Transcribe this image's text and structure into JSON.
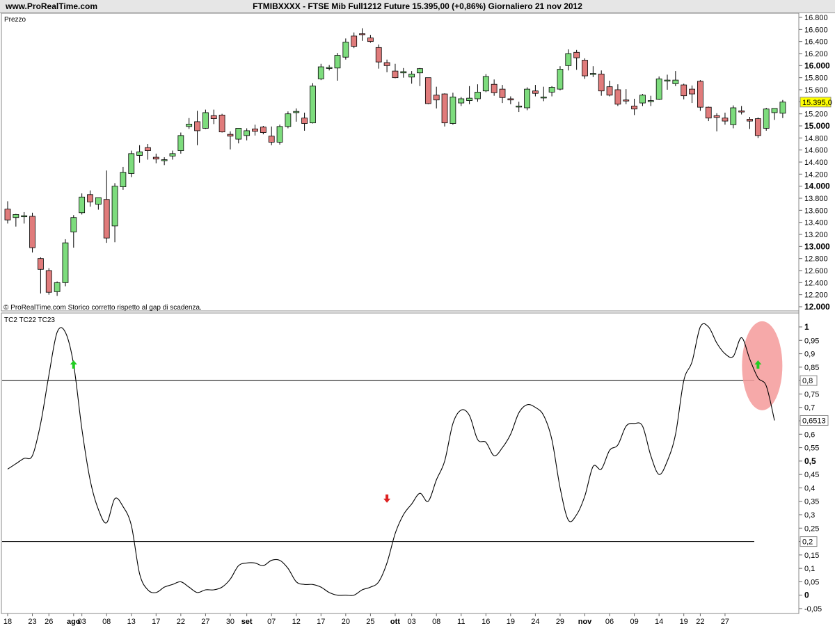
{
  "header": {
    "site": "www.ProRealTime.com",
    "info": "FTMIBXXXX - FTSE Mib Full1212 Future     15.395,00 (+0,86%)    Giornaliero  21 nov 2012"
  },
  "price_panel": {
    "label": "Prezzo",
    "footer": "© ProRealTime.com  Storico corretto rispetto al gap di scadenza.",
    "current_label": "15.395,0"
  },
  "indicator_panel": {
    "label": "TC2 TC22 TC23",
    "current_label": "0,6513",
    "upper_level_label": "0,8",
    "lower_level_label": "0,2"
  },
  "colors": {
    "up": "#7ddc7d",
    "down": "#e07b7b",
    "highlight": "#f59a9a",
    "arrow_up": "#22cc22",
    "arrow_down": "#dd2222",
    "current_box": "#ffff00"
  },
  "x_axis": {
    "labels": [
      {
        "i": 0,
        "text": "18"
      },
      {
        "i": 3,
        "text": "23"
      },
      {
        "i": 5,
        "text": "26"
      },
      {
        "i": 8,
        "text": "ago",
        "bold": true
      },
      {
        "i": 9,
        "text": "03"
      },
      {
        "i": 12,
        "text": "08"
      },
      {
        "i": 15,
        "text": "13"
      },
      {
        "i": 18,
        "text": "17"
      },
      {
        "i": 21,
        "text": "22"
      },
      {
        "i": 24,
        "text": "27"
      },
      {
        "i": 27,
        "text": "30"
      },
      {
        "i": 29,
        "text": "set",
        "bold": true
      },
      {
        "i": 32,
        "text": "07"
      },
      {
        "i": 35,
        "text": "12"
      },
      {
        "i": 38,
        "text": "17"
      },
      {
        "i": 41,
        "text": "20"
      },
      {
        "i": 44,
        "text": "25"
      },
      {
        "i": 47,
        "text": "ott",
        "bold": true
      },
      {
        "i": 49,
        "text": "03"
      },
      {
        "i": 52,
        "text": "08"
      },
      {
        "i": 55,
        "text": "11"
      },
      {
        "i": 58,
        "text": "16"
      },
      {
        "i": 61,
        "text": "19"
      },
      {
        "i": 64,
        "text": "24"
      },
      {
        "i": 67,
        "text": "29"
      },
      {
        "i": 70,
        "text": "nov",
        "bold": true
      },
      {
        "i": 73,
        "text": "06"
      },
      {
        "i": 76,
        "text": "09"
      },
      {
        "i": 79,
        "text": "14"
      },
      {
        "i": 82,
        "text": "19"
      },
      {
        "i": 84,
        "text": "22"
      },
      {
        "i": 87,
        "text": "27"
      }
    ]
  },
  "chart_data": [
    {
      "type": "candlestick",
      "ylim": [
        12000,
        16800
      ],
      "y_ticks": [
        12000,
        12200,
        12400,
        12600,
        12800,
        13000,
        13200,
        13400,
        13600,
        13800,
        14000,
        14200,
        14400,
        14600,
        14800,
        15000,
        15200,
        15400,
        15600,
        15800,
        16000,
        16200,
        16400,
        16600,
        16800
      ],
      "y_tick_labels": [
        "12.000",
        "12.200",
        "12.400",
        "12.600",
        "12.800",
        "13.000",
        "13.200",
        "13.400",
        "13.600",
        "13.800",
        "14.000",
        "14.200",
        "14.400",
        "14.600",
        "14.800",
        "15.000",
        "15.200",
        "15.400",
        "15.600",
        "15.800",
        "16.000",
        "16.200",
        "16.400",
        "16.600",
        "16.800"
      ],
      "y_major": [
        12000,
        13000,
        14000,
        15000,
        16000
      ],
      "candles": [
        {
          "o": 13620,
          "h": 13750,
          "l": 13380,
          "c": 13440
        },
        {
          "o": 13480,
          "h": 13540,
          "l": 13330,
          "c": 13530
        },
        {
          "o": 13510,
          "h": 13570,
          "l": 13380,
          "c": 13510
        },
        {
          "o": 13500,
          "h": 13560,
          "l": 12900,
          "c": 12980
        },
        {
          "o": 12800,
          "h": 12820,
          "l": 12220,
          "c": 12620
        },
        {
          "o": 12600,
          "h": 12640,
          "l": 12200,
          "c": 12240
        },
        {
          "o": 12250,
          "h": 12420,
          "l": 12180,
          "c": 12400
        },
        {
          "o": 12400,
          "h": 13120,
          "l": 12340,
          "c": 13060
        },
        {
          "o": 13240,
          "h": 13520,
          "l": 12980,
          "c": 13480
        },
        {
          "o": 13560,
          "h": 13880,
          "l": 13530,
          "c": 13820
        },
        {
          "o": 13860,
          "h": 13930,
          "l": 13660,
          "c": 13740
        },
        {
          "o": 13700,
          "h": 13810,
          "l": 13610,
          "c": 13810
        },
        {
          "o": 13780,
          "h": 14260,
          "l": 13060,
          "c": 13140
        },
        {
          "o": 13340,
          "h": 14050,
          "l": 13070,
          "c": 14000
        },
        {
          "o": 13990,
          "h": 14320,
          "l": 13940,
          "c": 14230
        },
        {
          "o": 14210,
          "h": 14590,
          "l": 14150,
          "c": 14540
        },
        {
          "o": 14510,
          "h": 14680,
          "l": 14390,
          "c": 14570
        },
        {
          "o": 14640,
          "h": 14700,
          "l": 14440,
          "c": 14590
        },
        {
          "o": 14480,
          "h": 14540,
          "l": 14380,
          "c": 14450
        },
        {
          "o": 14440,
          "h": 14480,
          "l": 14350,
          "c": 14440
        },
        {
          "o": 14500,
          "h": 14590,
          "l": 14440,
          "c": 14540
        },
        {
          "o": 14590,
          "h": 14890,
          "l": 14540,
          "c": 14840
        },
        {
          "o": 14990,
          "h": 15130,
          "l": 14950,
          "c": 15030
        },
        {
          "o": 15070,
          "h": 15250,
          "l": 14680,
          "c": 14920
        },
        {
          "o": 14960,
          "h": 15270,
          "l": 14950,
          "c": 15220
        },
        {
          "o": 15170,
          "h": 15270,
          "l": 15030,
          "c": 15120
        },
        {
          "o": 15180,
          "h": 15200,
          "l": 14890,
          "c": 14900
        },
        {
          "o": 14860,
          "h": 14910,
          "l": 14610,
          "c": 14830
        },
        {
          "o": 14780,
          "h": 14940,
          "l": 14710,
          "c": 14960
        },
        {
          "o": 14840,
          "h": 14960,
          "l": 14760,
          "c": 14920
        },
        {
          "o": 14950,
          "h": 15020,
          "l": 14840,
          "c": 14910
        },
        {
          "o": 14980,
          "h": 15000,
          "l": 14860,
          "c": 14890
        },
        {
          "o": 14830,
          "h": 14990,
          "l": 14680,
          "c": 14730
        },
        {
          "o": 14730,
          "h": 15020,
          "l": 14690,
          "c": 14990
        },
        {
          "o": 14990,
          "h": 15240,
          "l": 14960,
          "c": 15200
        },
        {
          "o": 15220,
          "h": 15290,
          "l": 15070,
          "c": 15240
        },
        {
          "o": 15130,
          "h": 15220,
          "l": 14920,
          "c": 15040
        },
        {
          "o": 15050,
          "h": 15710,
          "l": 15040,
          "c": 15660
        },
        {
          "o": 15780,
          "h": 16030,
          "l": 15760,
          "c": 15980
        },
        {
          "o": 15970,
          "h": 16010,
          "l": 15920,
          "c": 15970
        },
        {
          "o": 15960,
          "h": 16210,
          "l": 15750,
          "c": 16170
        },
        {
          "o": 16140,
          "h": 16450,
          "l": 16100,
          "c": 16390
        },
        {
          "o": 16490,
          "h": 16550,
          "l": 16290,
          "c": 16320
        },
        {
          "o": 16530,
          "h": 16620,
          "l": 16410,
          "c": 16520
        },
        {
          "o": 16460,
          "h": 16510,
          "l": 16380,
          "c": 16400
        },
        {
          "o": 16300,
          "h": 16350,
          "l": 15950,
          "c": 16060
        },
        {
          "o": 16050,
          "h": 16100,
          "l": 15890,
          "c": 16000
        },
        {
          "o": 15910,
          "h": 16030,
          "l": 15790,
          "c": 15800
        },
        {
          "o": 15880,
          "h": 15960,
          "l": 15800,
          "c": 15900
        },
        {
          "o": 15810,
          "h": 15910,
          "l": 15700,
          "c": 15860
        },
        {
          "o": 15880,
          "h": 15960,
          "l": 15660,
          "c": 15950
        },
        {
          "o": 15800,
          "h": 15800,
          "l": 15360,
          "c": 15370
        },
        {
          "o": 15510,
          "h": 15650,
          "l": 15290,
          "c": 15430
        },
        {
          "o": 15530,
          "h": 15540,
          "l": 14990,
          "c": 15050
        },
        {
          "o": 15040,
          "h": 15550,
          "l": 15020,
          "c": 15480
        },
        {
          "o": 15380,
          "h": 15480,
          "l": 15330,
          "c": 15450
        },
        {
          "o": 15420,
          "h": 15660,
          "l": 15360,
          "c": 15460
        },
        {
          "o": 15450,
          "h": 15690,
          "l": 15400,
          "c": 15560
        },
        {
          "o": 15580,
          "h": 15860,
          "l": 15560,
          "c": 15820
        },
        {
          "o": 15690,
          "h": 15770,
          "l": 15500,
          "c": 15550
        },
        {
          "o": 15610,
          "h": 15680,
          "l": 15380,
          "c": 15470
        },
        {
          "o": 15450,
          "h": 15490,
          "l": 15360,
          "c": 15430
        },
        {
          "o": 15330,
          "h": 15400,
          "l": 15230,
          "c": 15330
        },
        {
          "o": 15300,
          "h": 15640,
          "l": 15260,
          "c": 15610
        },
        {
          "o": 15580,
          "h": 15680,
          "l": 15490,
          "c": 15540
        },
        {
          "o": 15480,
          "h": 15650,
          "l": 15410,
          "c": 15480
        },
        {
          "o": 15560,
          "h": 15660,
          "l": 15490,
          "c": 15640
        },
        {
          "o": 15610,
          "h": 15990,
          "l": 15590,
          "c": 15940
        },
        {
          "o": 16000,
          "h": 16270,
          "l": 15920,
          "c": 16200
        },
        {
          "o": 16220,
          "h": 16260,
          "l": 15930,
          "c": 16130
        },
        {
          "o": 16090,
          "h": 16120,
          "l": 15780,
          "c": 15830
        },
        {
          "o": 15870,
          "h": 15990,
          "l": 15810,
          "c": 15870
        },
        {
          "o": 15860,
          "h": 15920,
          "l": 15500,
          "c": 15580
        },
        {
          "o": 15650,
          "h": 15750,
          "l": 15490,
          "c": 15510
        },
        {
          "o": 15600,
          "h": 15690,
          "l": 15330,
          "c": 15360
        },
        {
          "o": 15430,
          "h": 15610,
          "l": 15360,
          "c": 15420
        },
        {
          "o": 15330,
          "h": 15450,
          "l": 15180,
          "c": 15280
        },
        {
          "o": 15380,
          "h": 15530,
          "l": 15330,
          "c": 15510
        },
        {
          "o": 15410,
          "h": 15500,
          "l": 15330,
          "c": 15420
        },
        {
          "o": 15440,
          "h": 15820,
          "l": 15430,
          "c": 15780
        },
        {
          "o": 15760,
          "h": 15850,
          "l": 15600,
          "c": 15760
        },
        {
          "o": 15700,
          "h": 15910,
          "l": 15660,
          "c": 15760
        },
        {
          "o": 15680,
          "h": 15700,
          "l": 15440,
          "c": 15500
        },
        {
          "o": 15610,
          "h": 15670,
          "l": 15380,
          "c": 15530
        },
        {
          "o": 15740,
          "h": 15760,
          "l": 15250,
          "c": 15310
        },
        {
          "o": 15310,
          "h": 15320,
          "l": 15080,
          "c": 15130
        },
        {
          "o": 15170,
          "h": 15210,
          "l": 14910,
          "c": 15140
        },
        {
          "o": 15130,
          "h": 15220,
          "l": 15020,
          "c": 15080
        },
        {
          "o": 15020,
          "h": 15340,
          "l": 14960,
          "c": 15300
        },
        {
          "o": 15250,
          "h": 15330,
          "l": 15190,
          "c": 15230
        },
        {
          "o": 15110,
          "h": 15150,
          "l": 14950,
          "c": 15080
        },
        {
          "o": 15120,
          "h": 15140,
          "l": 14800,
          "c": 14840
        },
        {
          "o": 14960,
          "h": 15300,
          "l": 14920,
          "c": 15280
        },
        {
          "o": 15220,
          "h": 15290,
          "l": 15100,
          "c": 15290
        },
        {
          "o": 15210,
          "h": 15430,
          "l": 15130,
          "c": 15395
        }
      ]
    },
    {
      "type": "line",
      "name": "TC2 TC22 TC23",
      "ylim": [
        -0.05,
        1.0
      ],
      "y_ticks": [
        -0.05,
        0,
        0.05,
        0.1,
        0.15,
        0.2,
        0.25,
        0.3,
        0.35,
        0.4,
        0.45,
        0.5,
        0.55,
        0.6,
        0.65,
        0.7,
        0.75,
        0.8,
        0.85,
        0.9,
        0.95,
        1
      ],
      "y_tick_labels": [
        "-0,05",
        "0",
        "0,05",
        "0,1",
        "0,15",
        "0,2",
        "0,25",
        "0,3",
        "0,35",
        "0,4",
        "0,45",
        "0,5",
        "0,55",
        "0,6",
        "0,65",
        "0,7",
        "0,75",
        "0,8",
        "0,85",
        "0,9",
        "0,95",
        "1"
      ],
      "y_major": [
        0,
        0.5,
        1
      ],
      "levels": [
        0.8,
        0.2
      ],
      "values": [
        0.47,
        0.49,
        0.51,
        0.52,
        0.64,
        0.82,
        0.98,
        0.98,
        0.86,
        0.62,
        0.43,
        0.32,
        0.27,
        0.36,
        0.33,
        0.26,
        0.08,
        0.02,
        0.01,
        0.03,
        0.04,
        0.05,
        0.03,
        0.01,
        0.02,
        0.02,
        0.03,
        0.06,
        0.11,
        0.12,
        0.12,
        0.11,
        0.13,
        0.13,
        0.1,
        0.05,
        0.04,
        0.04,
        0.03,
        0.01,
        0.0,
        0.0,
        0.0,
        0.02,
        0.03,
        0.05,
        0.12,
        0.23,
        0.3,
        0.34,
        0.38,
        0.35,
        0.43,
        0.5,
        0.64,
        0.69,
        0.67,
        0.58,
        0.57,
        0.52,
        0.55,
        0.6,
        0.68,
        0.71,
        0.7,
        0.67,
        0.58,
        0.4,
        0.28,
        0.3,
        0.37,
        0.48,
        0.47,
        0.54,
        0.56,
        0.63,
        0.64,
        0.63,
        0.52,
        0.45,
        0.5,
        0.6,
        0.8,
        0.87,
        1.0,
        1.0,
        0.94,
        0.9,
        0.89,
        0.96,
        0.88,
        0.81,
        0.78,
        0.6513
      ],
      "arrows": [
        {
          "i": 8,
          "dir": "up",
          "y": 0.86
        },
        {
          "i": 46,
          "dir": "down",
          "y": 0.36
        },
        {
          "i": 91,
          "dir": "up",
          "y": 0.86
        }
      ],
      "highlight": {
        "i": 91,
        "y": 0.85
      }
    }
  ]
}
